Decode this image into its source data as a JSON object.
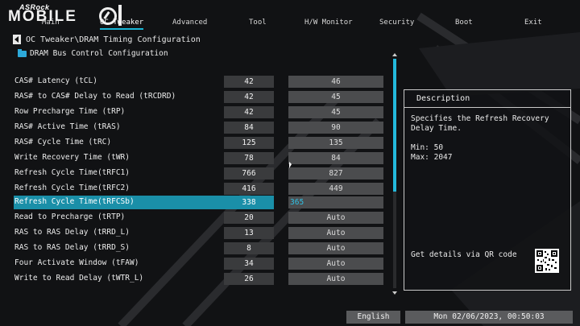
{
  "logo": {
    "brand": "ASRock",
    "product": "MOBILE"
  },
  "tabs": [
    {
      "label": "Main"
    },
    {
      "label": "OC Tweaker"
    },
    {
      "label": "Advanced"
    },
    {
      "label": "Tool"
    },
    {
      "label": "H/W Monitor"
    },
    {
      "label": "Security"
    },
    {
      "label": "Boot"
    },
    {
      "label": "Exit"
    }
  ],
  "breadcrumb": "OC Tweaker\\DRAM Timing Configuration",
  "section": "DRAM Bus Control Configuration",
  "rows": [
    {
      "label": "CAS# Latency (tCL)",
      "current": "42",
      "setting": "46"
    },
    {
      "label": "RAS# to CAS# Delay to Read  (tRCDRD)",
      "current": "42",
      "setting": "45"
    },
    {
      "label": "Row Precharge Time (tRP)",
      "current": "42",
      "setting": "45"
    },
    {
      "label": "RAS# Active Time (tRAS)",
      "current": "84",
      "setting": "90"
    },
    {
      "label": "RAS# Cycle Time (tRC)",
      "current": "125",
      "setting": "135"
    },
    {
      "label": "Write Recovery Time (tWR)",
      "current": "78",
      "setting": "84"
    },
    {
      "label": "Refresh Cycle Time(tRFC1)",
      "current": "766",
      "setting": "827"
    },
    {
      "label": "Refresh Cycle Time(tRFC2)",
      "current": "416",
      "setting": "449"
    },
    {
      "label": "Refresh Cycle Time(tRFCSb)",
      "current": "338",
      "setting": "365"
    },
    {
      "label": "Read to Precharge (tRTP)",
      "current": "20",
      "setting": "Auto"
    },
    {
      "label": "RAS to RAS Delay (tRRD_L)",
      "current": "13",
      "setting": "Auto"
    },
    {
      "label": "RAS to RAS Delay (tRRD_S)",
      "current": "8",
      "setting": "Auto"
    },
    {
      "label": "Four Activate Window (tFAW)",
      "current": "34",
      "setting": "Auto"
    },
    {
      "label": "Write to Read Delay (tWTR_L)",
      "current": "26",
      "setting": "Auto"
    }
  ],
  "selected_row": 8,
  "description": {
    "title": "Description",
    "text": "Specifies the Refresh Recovery Delay Time.",
    "min": "Min: 50",
    "max": "Max: 2047",
    "qr_text": "Get details via QR code"
  },
  "footer": {
    "language": "English",
    "datetime": "Mon 02/06/2023, 00:50:03"
  },
  "colors": {
    "accent": "#1a8fa8",
    "scroll": "#23b9dc",
    "background": "#111214"
  }
}
